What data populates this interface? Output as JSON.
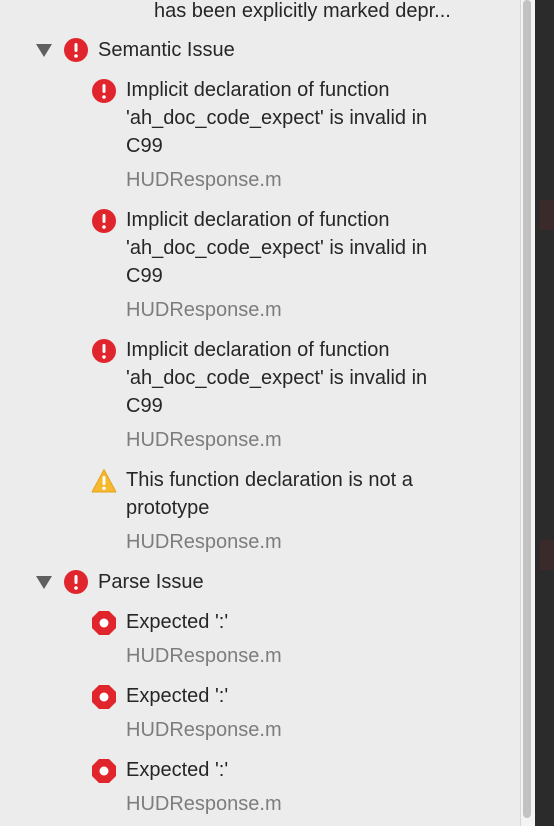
{
  "partial_row": {
    "message": "has been explicitly marked depr..."
  },
  "groups": [
    {
      "title": "Semantic Issue",
      "issues": [
        {
          "icon": "error-icon",
          "lines": [
            "Implicit declaration of function",
            "'ah_doc_code_expect' is invalid in",
            "C99"
          ],
          "file": "HUDResponse.m"
        },
        {
          "icon": "error-icon",
          "lines": [
            "Implicit declaration of function",
            "'ah_doc_code_expect' is invalid in",
            "C99"
          ],
          "file": "HUDResponse.m"
        },
        {
          "icon": "error-icon",
          "lines": [
            "Implicit declaration of function",
            "'ah_doc_code_expect' is invalid in",
            "C99"
          ],
          "file": "HUDResponse.m"
        },
        {
          "icon": "warning-icon",
          "lines": [
            "This function declaration is not a",
            "prototype"
          ],
          "file": "HUDResponse.m"
        }
      ]
    },
    {
      "title": "Parse Issue",
      "issues": [
        {
          "icon": "stop-error-icon",
          "lines": [
            "Expected ':'"
          ],
          "file": "HUDResponse.m"
        },
        {
          "icon": "stop-error-icon",
          "lines": [
            "Expected ':'"
          ],
          "file": "HUDResponse.m"
        },
        {
          "icon": "stop-error-icon",
          "lines": [
            "Expected ':'"
          ],
          "file": "HUDResponse.m"
        }
      ]
    }
  ],
  "colors": {
    "error": "#e0262c",
    "warning": "#f5b82e",
    "panel_bg": "#ececec",
    "file_text": "#7d7d7d"
  }
}
